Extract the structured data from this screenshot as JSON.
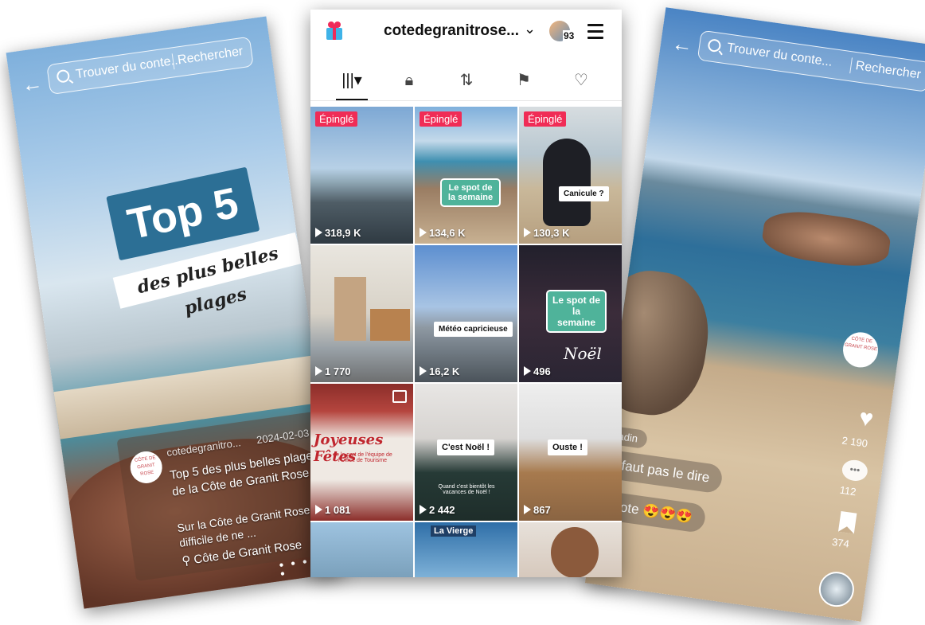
{
  "left_screen": {
    "search_placeholder": "Trouver du conte...",
    "search_button": "Rechercher",
    "overlay_title": "Top 5",
    "overlay_subtitle": "des plus belles plages",
    "author": "cotedegranitro...",
    "date": "2024-02-03",
    "caption_title": "Top 5 des plus belles plages de la Côte de Granit Rose",
    "caption_text": "Sur la Côte de Granit Rose, difficile de ne ...",
    "location": "Côte de Granit Rose",
    "logo_text": "CÔTE DE GRANIT ROSE"
  },
  "center_screen": {
    "username": "cotedegranitrose...",
    "notification_count": "93",
    "tabs": [
      {
        "icon": "grid-icon"
      },
      {
        "icon": "lock-icon"
      },
      {
        "icon": "repost-icon"
      },
      {
        "icon": "bookmark-icon"
      },
      {
        "icon": "liked-icon"
      }
    ],
    "pinned_label": "Épinglé",
    "videos": [
      {
        "views": "318,9 K",
        "pinned": true,
        "overlay": ""
      },
      {
        "views": "134,6 K",
        "pinned": true,
        "overlay": "Le spot de la semaine"
      },
      {
        "views": "130,3 K",
        "pinned": true,
        "overlay": "Canicule ?"
      },
      {
        "views": "1 770",
        "pinned": false,
        "overlay": ""
      },
      {
        "views": "16,2 K",
        "pinned": false,
        "overlay": "Météo capricieuse"
      },
      {
        "views": "496",
        "pinned": false,
        "overlay": "Le spot de la semaine"
      },
      {
        "views": "1 081",
        "pinned": false,
        "overlay": "Joyeuses Fêtes"
      },
      {
        "views": "2 442",
        "pinned": false,
        "overlay": "C'est Noël !"
      },
      {
        "views": "867",
        "pinned": false,
        "overlay": "Ouste !"
      },
      {
        "views": "",
        "pinned": false,
        "overlay": ""
      },
      {
        "views": "",
        "pinned": false,
        "overlay": "La Vierge"
      },
      {
        "views": "",
        "pinned": false,
        "overlay": ""
      }
    ],
    "small_texts": {
      "joyeuses_sub": "de la part de l'équipe de l'Office de Tourisme",
      "noel_sub": "Quand c'est bientôt les vacances de Noël !",
      "noel_script": "Noël"
    }
  },
  "right_screen": {
    "search_placeholder": "Trouver du conte...",
    "search_button": "Rechercher",
    "likes": "2 190",
    "comments": "112",
    "saves": "374",
    "comment_1_author": "ukadin",
    "comment_1": "ut faut pas le dire",
    "comment_2": "renote 😍😍😍",
    "logo_text": "CÔTE DE GRANIT ROSE"
  },
  "colors": {
    "pin_red": "#f02c56",
    "badge_green": "#4fb39a",
    "overlay_blue": "#2c6f95"
  }
}
